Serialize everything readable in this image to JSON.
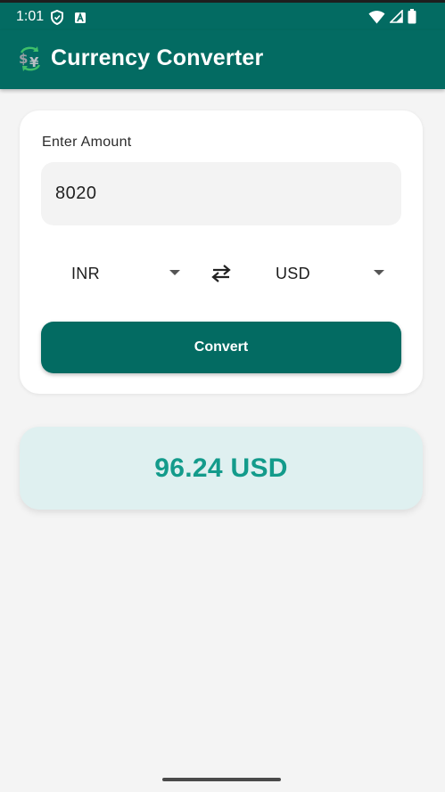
{
  "status_bar": {
    "time": "1:01",
    "left_icons": [
      "shield-icon",
      "text-a-icon"
    ],
    "right_icons": [
      "wifi-icon",
      "signal-icon",
      "battery-icon"
    ]
  },
  "app_bar": {
    "title": "Currency Converter",
    "logo_icon": "currency-exchange-icon"
  },
  "converter": {
    "amount_label": "Enter Amount",
    "amount_value": "8020",
    "from_currency": "INR",
    "to_currency": "USD",
    "swap_icon": "swap-arrows-icon",
    "convert_label": "Convert"
  },
  "result": {
    "text": "96.24 USD"
  },
  "colors": {
    "primary": "#036b62",
    "result_text": "#139b8b",
    "result_background": "#dff0f0",
    "page_background": "#f4f4f4"
  }
}
